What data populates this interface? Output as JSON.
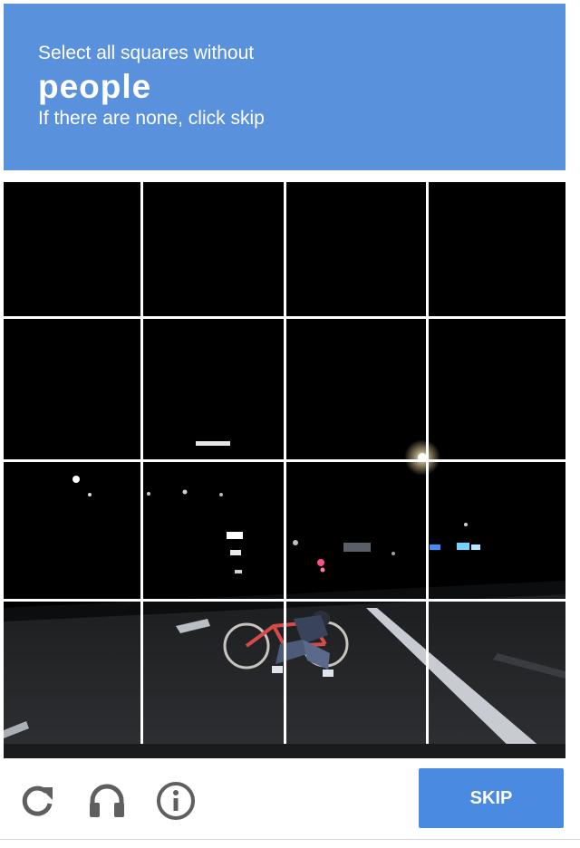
{
  "header": {
    "instruction": "Select all squares without",
    "target": "people",
    "subtext": "If there are none, click skip"
  },
  "grid": {
    "rows": 4,
    "columns": 4
  },
  "footer": {
    "reload_icon": "reload-icon",
    "audio_icon": "headphones-icon",
    "info_icon": "info-icon",
    "skip_label": "SKIP"
  },
  "colors": {
    "header_bg": "#5a91dc",
    "skip_bg": "#4a8ae0",
    "icon_gray": "#5f5f5f"
  }
}
